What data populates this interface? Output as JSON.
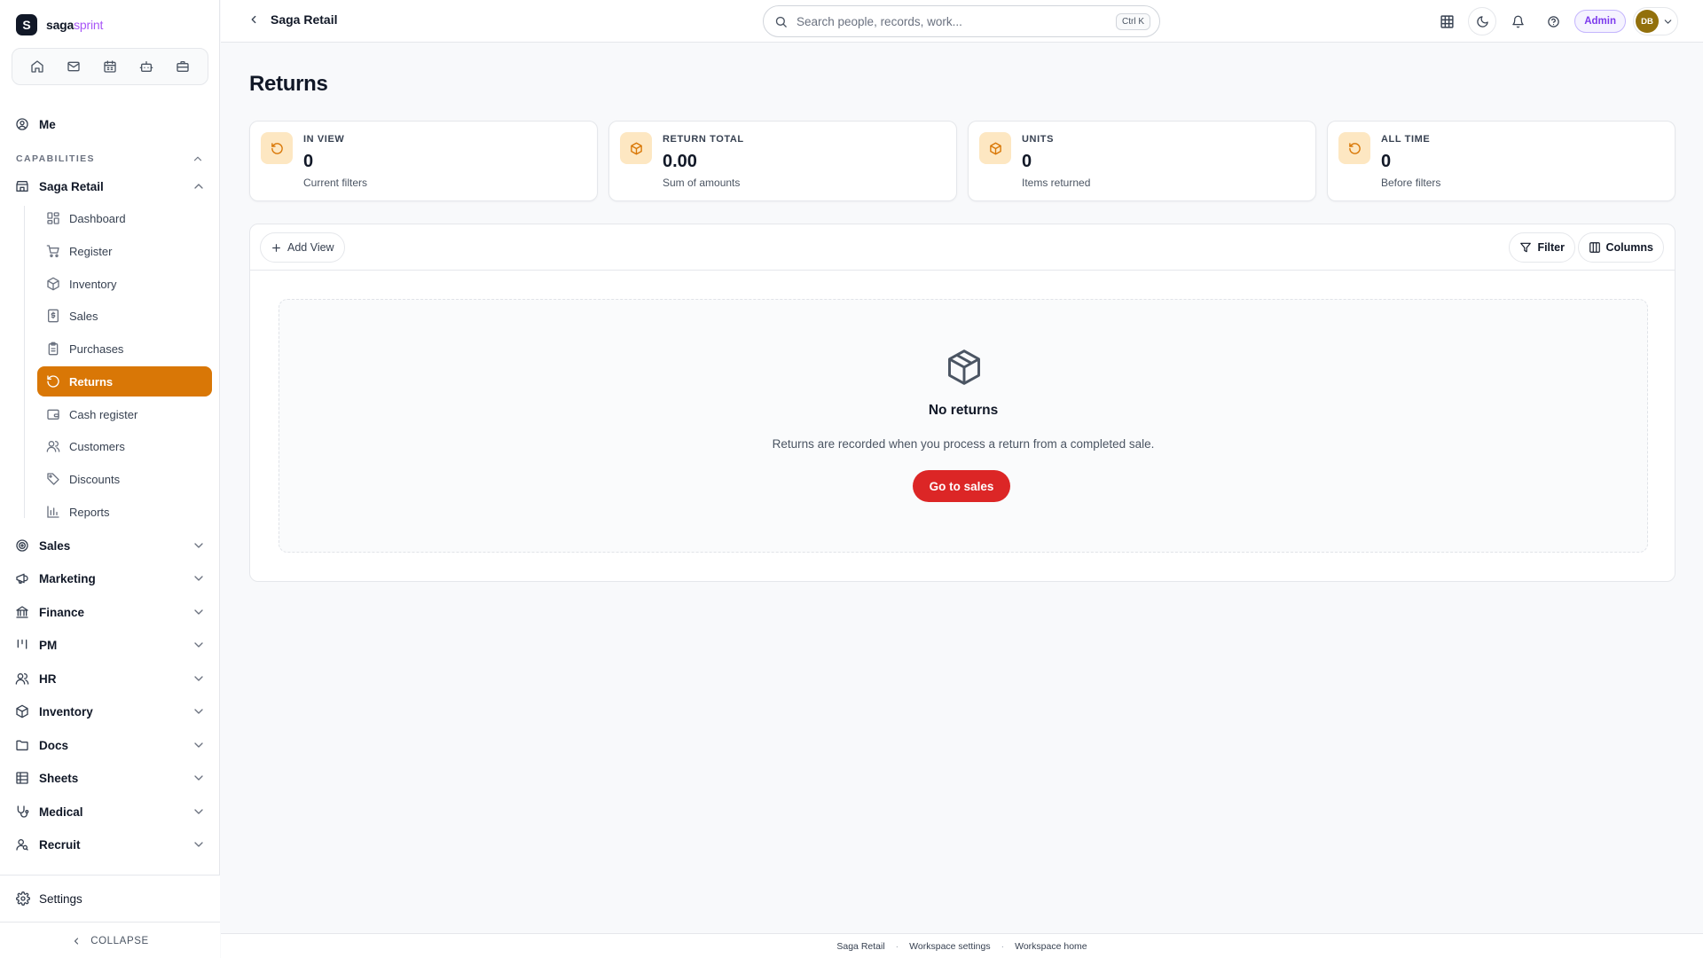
{
  "brand": {
    "mark": "S",
    "name_primary": "saga",
    "name_accent": "sprint"
  },
  "quick_bar": [
    "home-icon",
    "mail-icon",
    "calendar-icon",
    "bot-icon",
    "briefcase-icon"
  ],
  "nav": {
    "me": "Me",
    "section_label": "CAPABILITIES",
    "app": "Saga Retail",
    "sub_items": [
      {
        "label": "Dashboard",
        "icon": "dashboard-icon"
      },
      {
        "label": "Register",
        "icon": "cart-icon"
      },
      {
        "label": "Inventory",
        "icon": "box-icon"
      },
      {
        "label": "Sales",
        "icon": "receipt-icon"
      },
      {
        "label": "Purchases",
        "icon": "clipboard-icon"
      },
      {
        "label": "Returns",
        "icon": "return-icon",
        "active": true
      },
      {
        "label": "Cash register",
        "icon": "wallet-icon"
      },
      {
        "label": "Customers",
        "icon": "users-icon"
      },
      {
        "label": "Discounts",
        "icon": "tag-icon"
      },
      {
        "label": "Reports",
        "icon": "bar-chart-icon"
      }
    ],
    "groups": [
      {
        "label": "Sales",
        "icon": "target-icon"
      },
      {
        "label": "Marketing",
        "icon": "megaphone-icon"
      },
      {
        "label": "Finance",
        "icon": "bank-icon"
      },
      {
        "label": "PM",
        "icon": "kanban-icon"
      },
      {
        "label": "HR",
        "icon": "people-icon"
      },
      {
        "label": "Inventory",
        "icon": "box-icon"
      },
      {
        "label": "Docs",
        "icon": "folder-icon"
      },
      {
        "label": "Sheets",
        "icon": "table-icon"
      },
      {
        "label": "Medical",
        "icon": "stethoscope-icon"
      },
      {
        "label": "Recruit",
        "icon": "user-search-icon"
      }
    ],
    "settings": "Settings",
    "collapse": "COLLAPSE"
  },
  "topbar": {
    "crumb": "Saga Retail",
    "search_placeholder": "Search people, records, work...",
    "shortcut": "Ctrl K",
    "role": "Admin",
    "avatar_initials": "DB"
  },
  "page": {
    "title": "Returns",
    "stats": [
      {
        "label": "IN VIEW",
        "value": "0",
        "sub": "Current filters",
        "icon": "return-icon"
      },
      {
        "label": "RETURN TOTAL",
        "value": "0.00",
        "sub": "Sum of amounts",
        "icon": "box-icon"
      },
      {
        "label": "UNITS",
        "value": "0",
        "sub": "Items returned",
        "icon": "box-icon"
      },
      {
        "label": "ALL TIME",
        "value": "0",
        "sub": "Before filters",
        "icon": "return-icon"
      }
    ],
    "toolbar": {
      "add_view": "Add View",
      "filter": "Filter",
      "columns": "Columns"
    },
    "empty": {
      "title": "No returns",
      "description": "Returns are recorded when you process a return from a completed sale.",
      "cta": "Go to sales"
    }
  },
  "footer": {
    "links": [
      "Saga Retail",
      "Workspace settings",
      "Workspace home"
    ]
  },
  "colors": {
    "accent": "#d97706",
    "cta": "#dc2626",
    "role": "#7c3aed"
  }
}
